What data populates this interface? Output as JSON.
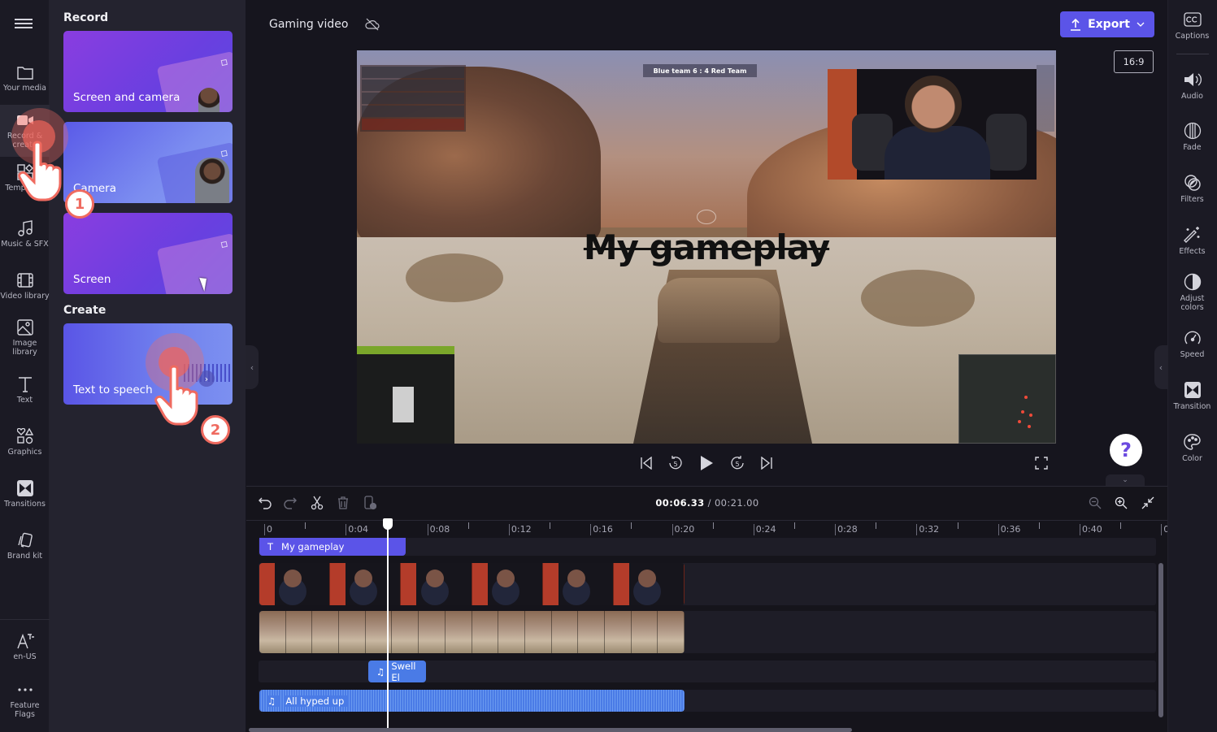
{
  "project": {
    "title": "Gaming video",
    "cloud_status_icon": "cloud-off-icon"
  },
  "export": {
    "label": "Export"
  },
  "aspect_ratio": "16:9",
  "left_rail": {
    "items": [
      {
        "id": "your-media",
        "label": "Your media",
        "icon": "folder-icon"
      },
      {
        "id": "record-create",
        "label": "Record &\ncreate",
        "icon": "camera-icon",
        "active": true
      },
      {
        "id": "templates",
        "label": "Templates",
        "icon": "templates-icon"
      },
      {
        "id": "music-sfx",
        "label": "Music & SFX",
        "icon": "music-note-icon"
      },
      {
        "id": "video-library",
        "label": "Video library",
        "icon": "film-icon"
      },
      {
        "id": "image-library",
        "label": "Image\nlibrary",
        "icon": "image-icon"
      },
      {
        "id": "text",
        "label": "Text",
        "icon": "text-icon"
      },
      {
        "id": "graphics",
        "label": "Graphics",
        "icon": "shapes-icon"
      },
      {
        "id": "transitions",
        "label": "Transitions",
        "icon": "transition-icon"
      },
      {
        "id": "brand-kit",
        "label": "Brand kit",
        "icon": "brand-kit-icon"
      }
    ],
    "bottom": [
      {
        "id": "language",
        "label": "en-US",
        "icon": "language-icon"
      },
      {
        "id": "feature-flags",
        "label": "Feature\nFlags",
        "icon": "more-icon"
      }
    ]
  },
  "panel": {
    "record_title": "Record",
    "record_cards": [
      {
        "label": "Screen and camera"
      },
      {
        "label": "Camera"
      },
      {
        "label": "Screen"
      }
    ],
    "create_title": "Create",
    "create_cards": [
      {
        "label": "Text to speech"
      }
    ]
  },
  "tutorial": {
    "step1": "1",
    "step2": "2"
  },
  "preview": {
    "scoreboard": "Blue team 6 : 4  Red Team",
    "overlay_text": "My gameplay"
  },
  "playback": {
    "buttons": [
      "skip-back",
      "rewind-5",
      "play",
      "forward-5",
      "skip-forward"
    ],
    "rewind_seconds": "5",
    "forward_seconds": "5"
  },
  "timeline": {
    "current_time": "00:06.33",
    "separator": " / ",
    "total_time": "00:21.00",
    "ruler_labels": [
      "0",
      "0:04",
      "0:08",
      "0:12",
      "0:16",
      "0:20",
      "0:24",
      "0:28",
      "0:32",
      "0:36",
      "0:40",
      "0:"
    ],
    "tracks": {
      "text_clip": "My gameplay",
      "audio_clip_1": "Swell El",
      "audio_clip_2": "All hyped up"
    }
  },
  "right_rail": {
    "items": [
      {
        "id": "captions",
        "label": "Captions",
        "icon": "cc-icon"
      },
      {
        "id": "audio",
        "label": "Audio",
        "icon": "speaker-icon"
      },
      {
        "id": "fade",
        "label": "Fade",
        "icon": "fade-icon"
      },
      {
        "id": "filters",
        "label": "Filters",
        "icon": "filters-icon"
      },
      {
        "id": "effects",
        "label": "Effects",
        "icon": "magic-wand-icon"
      },
      {
        "id": "adjust-colors",
        "label": "Adjust\ncolors",
        "icon": "contrast-icon"
      },
      {
        "id": "speed",
        "label": "Speed",
        "icon": "speedometer-icon"
      },
      {
        "id": "transition",
        "label": "Transition",
        "icon": "transition-icon"
      },
      {
        "id": "color",
        "label": "Color",
        "icon": "palette-icon"
      }
    ]
  },
  "help": {
    "label": "?"
  },
  "colors": {
    "accent": "#5b54e8",
    "audio_clip": "#4a7be6",
    "tutorial": "#ef6a5f"
  }
}
